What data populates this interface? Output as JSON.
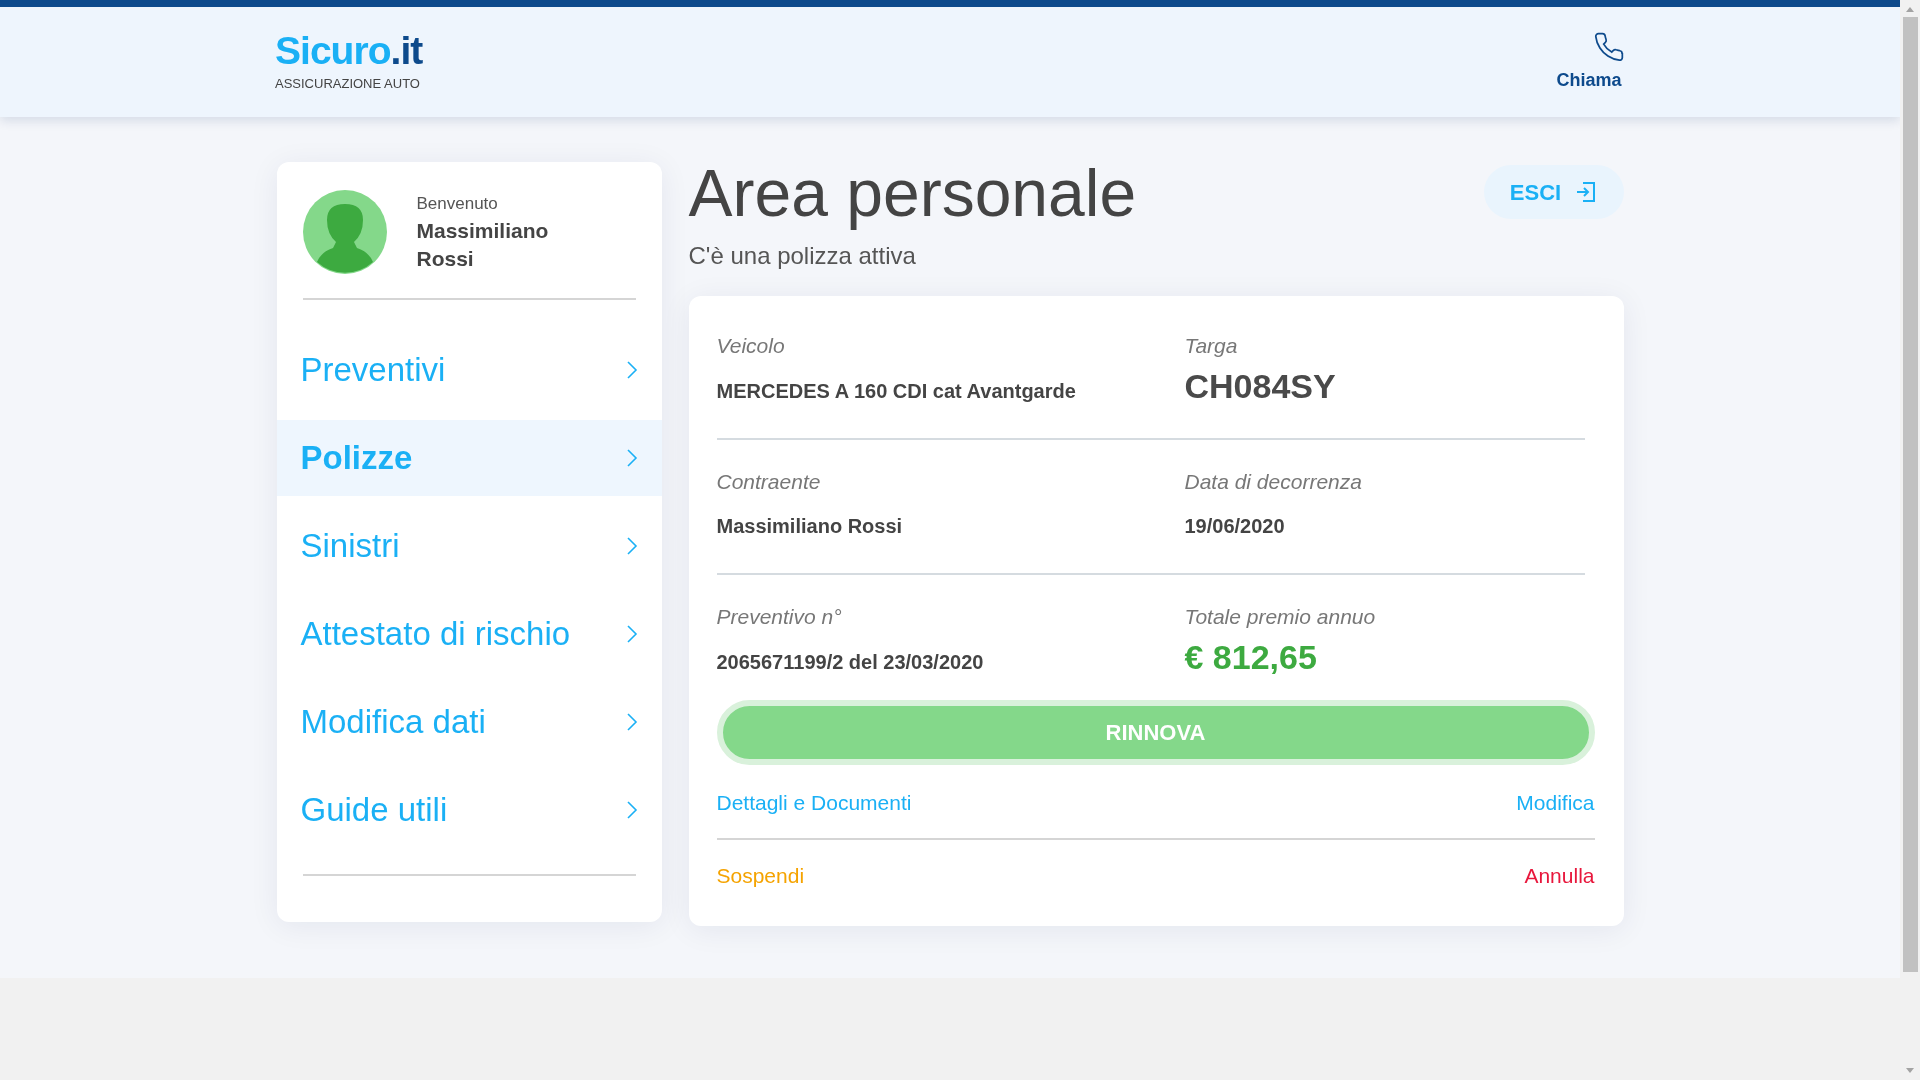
{
  "header": {
    "logo_main": "Sicuro",
    "logo_suffix": ".it",
    "tagline": "ASSICURAZIONE AUTO",
    "call_label": "Chiama"
  },
  "user": {
    "greeting": "Benvenuto",
    "name": "Massimiliano Rossi"
  },
  "menu": [
    {
      "label": "Preventivi",
      "selected": false
    },
    {
      "label": "Polizze",
      "selected": true
    },
    {
      "label": "Sinistri",
      "selected": false
    },
    {
      "label": "Attestato di rischio",
      "selected": false
    },
    {
      "label": "Modifica dati",
      "selected": false
    },
    {
      "label": "Guide utili",
      "selected": false
    }
  ],
  "page": {
    "title": "Area personale",
    "subtitle": "C'è una polizza attiva",
    "logout_label": "ESCI"
  },
  "policy": {
    "rows": [
      [
        {
          "label": "Veicolo",
          "value": "MERCEDES A 160 CDI cat Avantgarde",
          "kind": "text"
        },
        {
          "label": "Targa",
          "value": "CH084SY",
          "kind": "plate"
        }
      ],
      [
        {
          "label": "Contraente",
          "value": "Massimiliano Rossi",
          "kind": "text"
        },
        {
          "label": "Data di decorrenza",
          "value": "19/06/2020",
          "kind": "text"
        }
      ],
      [
        {
          "label": "Preventivo n°",
          "value": "2065671199/2 del 23/03/2020",
          "kind": "text"
        },
        {
          "label": "Totale premio annuo",
          "value": "€ 812,65",
          "kind": "price"
        }
      ]
    ],
    "primary_action": "RINNOVA",
    "action_rows": [
      [
        {
          "label": "Dettagli e Documenti",
          "color": "#1ab0f5"
        },
        {
          "label": "Modifica",
          "color": "#1ab0f5"
        }
      ],
      [
        {
          "label": "Sospendi",
          "color": "#f5a300"
        },
        {
          "label": "Annulla",
          "color": "#e8173c"
        }
      ]
    ]
  }
}
